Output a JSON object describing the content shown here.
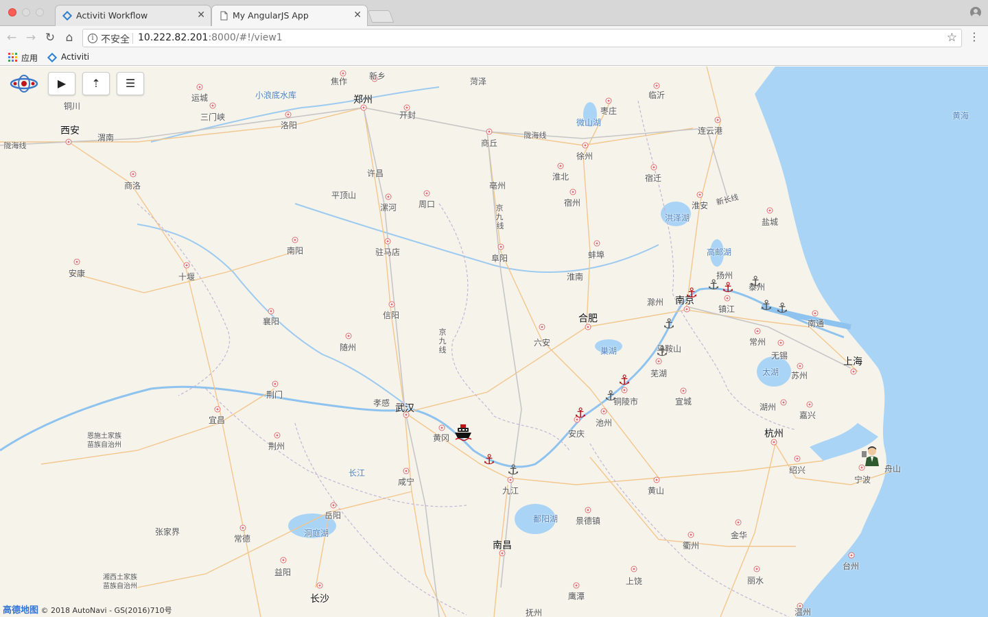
{
  "browser": {
    "tabs": [
      {
        "title": "Activiti Workflow",
        "active": false
      },
      {
        "title": "My AngularJS App",
        "active": true
      }
    ],
    "security_label": "不安全",
    "url_host": "10.222.82.201",
    "url_rest": ":8000/#!/view1",
    "bookmarks": {
      "apps_label": "应用",
      "activiti_label": "Activiti"
    }
  },
  "map": {
    "controls": {
      "play": "▶",
      "upload": "⇡",
      "menu": "☰"
    },
    "footer": {
      "brand": "高德地图",
      "copyright": "© 2018 AutoNavi - GS(2016)710号"
    },
    "labels": {
      "zhengzhou": "郑州",
      "xian": "西安",
      "wuhan": "武汉",
      "hefei": "合肥",
      "nanjing": "南京",
      "shanghai": "上海",
      "hangzhou": "杭州",
      "nanchang": "南昌",
      "changsha": "长沙",
      "tongchuan": "铜川",
      "weinan": "渭南",
      "shangluo": "商洛",
      "ankang": "安康",
      "shiyan": "十堰",
      "yuncheng": "运城",
      "sanmenxia": "三门峡",
      "luoyang": "洛阳",
      "jiaozuo": "焦作",
      "xinxiang": "新乡",
      "kaifeng": "开封",
      "heze": "菏泽",
      "xuchang": "许昌",
      "pingdingshan": "平顶山",
      "luohe": "漯河",
      "zhoukou": "周口",
      "nanyang": "南阳",
      "zhumadian": "驻马店",
      "xinyang": "信阳",
      "xiangyang": "襄阳",
      "suizhou": "随州",
      "jingmen": "荆门",
      "yichang": "宜昌",
      "jingzhou": "荆州",
      "xiaogan": "孝感",
      "huanggang": "黄冈",
      "xianning": "咸宁",
      "yueyang": "岳阳",
      "changde": "常德",
      "zhangjiajie": "张家界",
      "yiyang": "益阳",
      "enshi": "恩施土家族",
      "enshi2": "苗族自治州",
      "xiangxi": "湘西土家族",
      "xiangxi2": "苗族自治州",
      "shangqiu": "商丘",
      "bozhou": "亳州",
      "fuyang": "阜阳",
      "huaibei": "淮北",
      "suzhou_ah": "宿州",
      "bengbu": "蚌埠",
      "huainan": "淮南",
      "luan": "六安",
      "chuzhou": "滁州",
      "maanshan": "马鞍山",
      "wuhu": "芜湖",
      "tongling": "铜陵市",
      "chizhou": "池州",
      "anqing": "安庆",
      "xuancheng": "宣城",
      "huangshan": "黄山",
      "jiujiang": "九江",
      "jingdezhen": "景德镇",
      "shangrao": "上饶",
      "yingtan": "鹰潭",
      "fuzhou_jx": "抚州",
      "quzhou": "衢州",
      "jinhua": "金华",
      "lishui": "丽水",
      "taizhou_zj": "台州",
      "wenzhou": "温州",
      "shaoxing": "绍兴",
      "ningbo": "宁波",
      "zhoushan": "舟山",
      "huzhou": "湖州",
      "jiaxing": "嘉兴",
      "suzhou_js": "苏州",
      "wuxi": "无锡",
      "changzhou": "常州",
      "zhenjiang": "镇江",
      "yangzhou": "扬州",
      "taizhou_js": "泰州",
      "nantong": "南通",
      "yancheng": "盐城",
      "huaian": "淮安",
      "suqian": "宿迁",
      "xuzhou": "徐州",
      "lianyungang": "连云港",
      "linyi": "临沂",
      "zaozhuang": "枣庄",
      "huanghai": "黄海",
      "xiaolangdi": "小浪底水库",
      "weishanhu": "微山湖",
      "hongzehu": "洪泽湖",
      "gaoyouhu": "高邮湖",
      "chaohu": "巢湖",
      "taihu": "太湖",
      "poyanghu": "鄱阳湖",
      "dongtinghu": "洞庭湖",
      "changjiang": "长江",
      "longhai1": "陇海线",
      "longhai2": "陇海线",
      "xinchang": "新长线",
      "jingjiu1": "京",
      "jingjiu2": "九",
      "jingjiu3": "线",
      "jingjiu4": "京",
      "jingjiu5": "九",
      "jingjiu6": "线"
    }
  }
}
